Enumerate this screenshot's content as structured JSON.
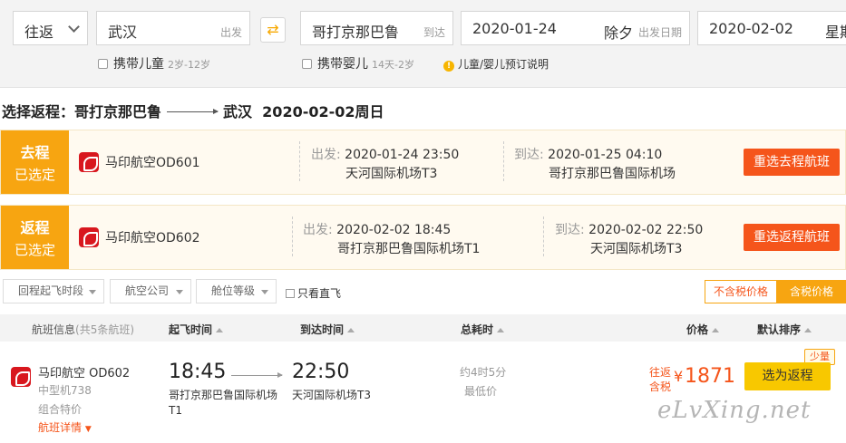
{
  "search": {
    "trip_type": "往返",
    "from_city": "武汉",
    "from_hint": "出发",
    "swap_icon": "swap-icon",
    "to_city": "哥打京那巴鲁",
    "to_hint": "到达",
    "depart_date": "2020-01-24",
    "depart_holiday": "除夕",
    "depart_hint": "出发日期",
    "return_date": "2020-02-02",
    "return_weekday": "星期"
  },
  "options": {
    "child_label": "携带儿童",
    "child_age": "2岁-12岁",
    "infant_label": "携带婴儿",
    "infant_age": "14天-2岁",
    "info_link": "儿童/婴儿预订说明"
  },
  "title": {
    "prefix": "选择返程：哥打京那巴鲁",
    "dest": "武汉",
    "date": "2020-02-02周日"
  },
  "selected": [
    {
      "tag_top": "去程",
      "tag_bottom": "已选定",
      "airline": "马印航空OD601",
      "dep_label": "出发: ",
      "dep_time": "2020-01-24 23:50",
      "dep_airport": "天河国际机场T3",
      "arr_label": "到达: ",
      "arr_time": "2020-01-25 04:10",
      "arr_airport": "哥打京那巴鲁国际机场",
      "button": "重选去程航班"
    },
    {
      "tag_top": "返程",
      "tag_bottom": "已选定",
      "airline": "马印航空OD602",
      "dep_label": "出发: ",
      "dep_time": "2020-02-02 18:45",
      "dep_airport": "哥打京那巴鲁国际机场T1",
      "arr_label": "到达: ",
      "arr_time": "2020-02-02 22:50",
      "arr_airport": "天河国际机场T3",
      "button": "重选返程航班"
    }
  ],
  "filters": {
    "dep_time": "回程起飞时段",
    "airline": "航空公司",
    "cabin": "舱位等级",
    "direct": "只看直飞",
    "price_excl": "不含税价格",
    "price_incl": "含税价格"
  },
  "table_header": {
    "flight_info": "航班信息",
    "flight_count": "(共5条航班)",
    "dep_time": "起飞时间",
    "arr_time": "到达时间",
    "duration": "总耗时",
    "price": "价格",
    "default_sort": "默认排序"
  },
  "flight": {
    "airline": "马印航空 OD602",
    "aircraft": "中型机738",
    "combo": "组合特价",
    "details": "航班详情",
    "dep_time": "18:45",
    "dep_airport": "哥打京那巴鲁国际机场",
    "dep_terminal": "T1",
    "arr_time": "22:50",
    "arr_airport": "天河国际机场T3",
    "duration": "约4时5分",
    "lowest": "最低价",
    "price_label1": "往返",
    "price_label2": "含税",
    "currency": "¥",
    "price": "1871",
    "badge": "少量",
    "choose_button": "选为返程"
  },
  "watermark": "eLvXing.net",
  "colors": {
    "accent": "#f7a511",
    "cta": "#f5551b",
    "choose": "#f8c800"
  }
}
